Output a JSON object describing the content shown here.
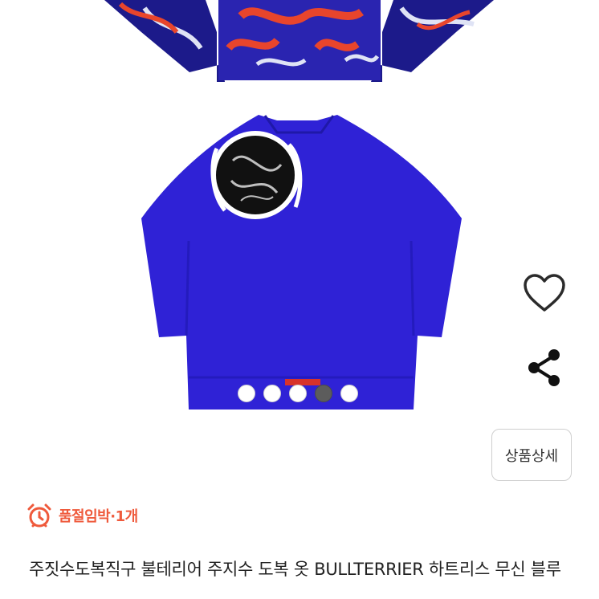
{
  "product": {
    "title": "주짓수도복직구 불테리어 주지수 도복 옷 BULLTERRIER 하트리스 무신 블루",
    "stock_badge": "품절임박·1개",
    "detail_button_label": "상품상세",
    "image_count": 5,
    "active_image_index": 3
  },
  "icons": {
    "wishlist": "heart-outline-icon",
    "share": "share-icon",
    "stock": "alarm-clock-icon"
  },
  "colors": {
    "gi_blue": "#2f22d6",
    "stock_accent": "#ef5a3c",
    "dot_active": "#5c5c5c"
  }
}
